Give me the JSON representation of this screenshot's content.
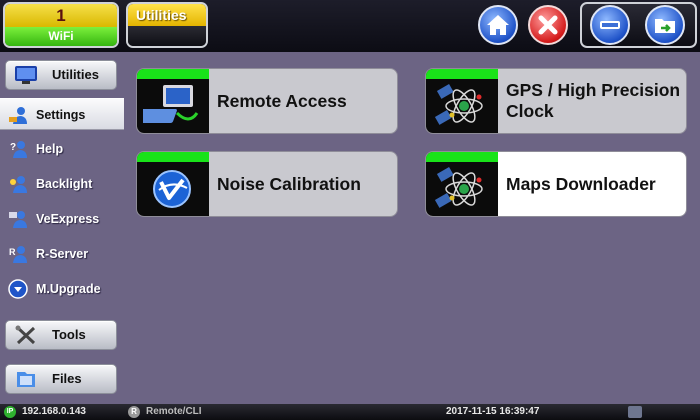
{
  "header": {
    "wifi": {
      "channel": "1",
      "label": "WiFi"
    },
    "title": "Utilities"
  },
  "sidebar": {
    "top_button": {
      "label": "Utilities",
      "icon": "monitor-icon"
    },
    "items": [
      {
        "label": "Settings",
        "icon": "settings-user-icon",
        "selected": true
      },
      {
        "label": "Help",
        "icon": "help-icon"
      },
      {
        "label": "Backlight",
        "icon": "backlight-icon"
      },
      {
        "label": "VeExpress",
        "icon": "veexpress-icon"
      },
      {
        "label": "R-Server",
        "icon": "r-server-icon"
      },
      {
        "label": "M.Upgrade",
        "icon": "upgrade-icon"
      }
    ],
    "bottom_buttons": [
      {
        "label": "Tools",
        "icon": "tools-icon"
      },
      {
        "label": "Files",
        "icon": "files-icon"
      }
    ]
  },
  "cards": [
    {
      "label": "Remote Access",
      "icon": "remote-access-icon"
    },
    {
      "label": "GPS / High Precision Clock",
      "icon": "gps-satellite-icon"
    },
    {
      "label": "Noise Calibration",
      "icon": "noise-calibration-icon"
    },
    {
      "label": "Maps Downloader",
      "icon": "maps-satellite-icon",
      "active": true
    }
  ],
  "status": {
    "ip": "192.168.0.143",
    "remote": "Remote/CLI",
    "datetime": "2017-11-15  16:39:47"
  },
  "colors": {
    "background": "#6c6484",
    "accent_green": "#19e319",
    "accent_yellow": "#ffe24a"
  }
}
